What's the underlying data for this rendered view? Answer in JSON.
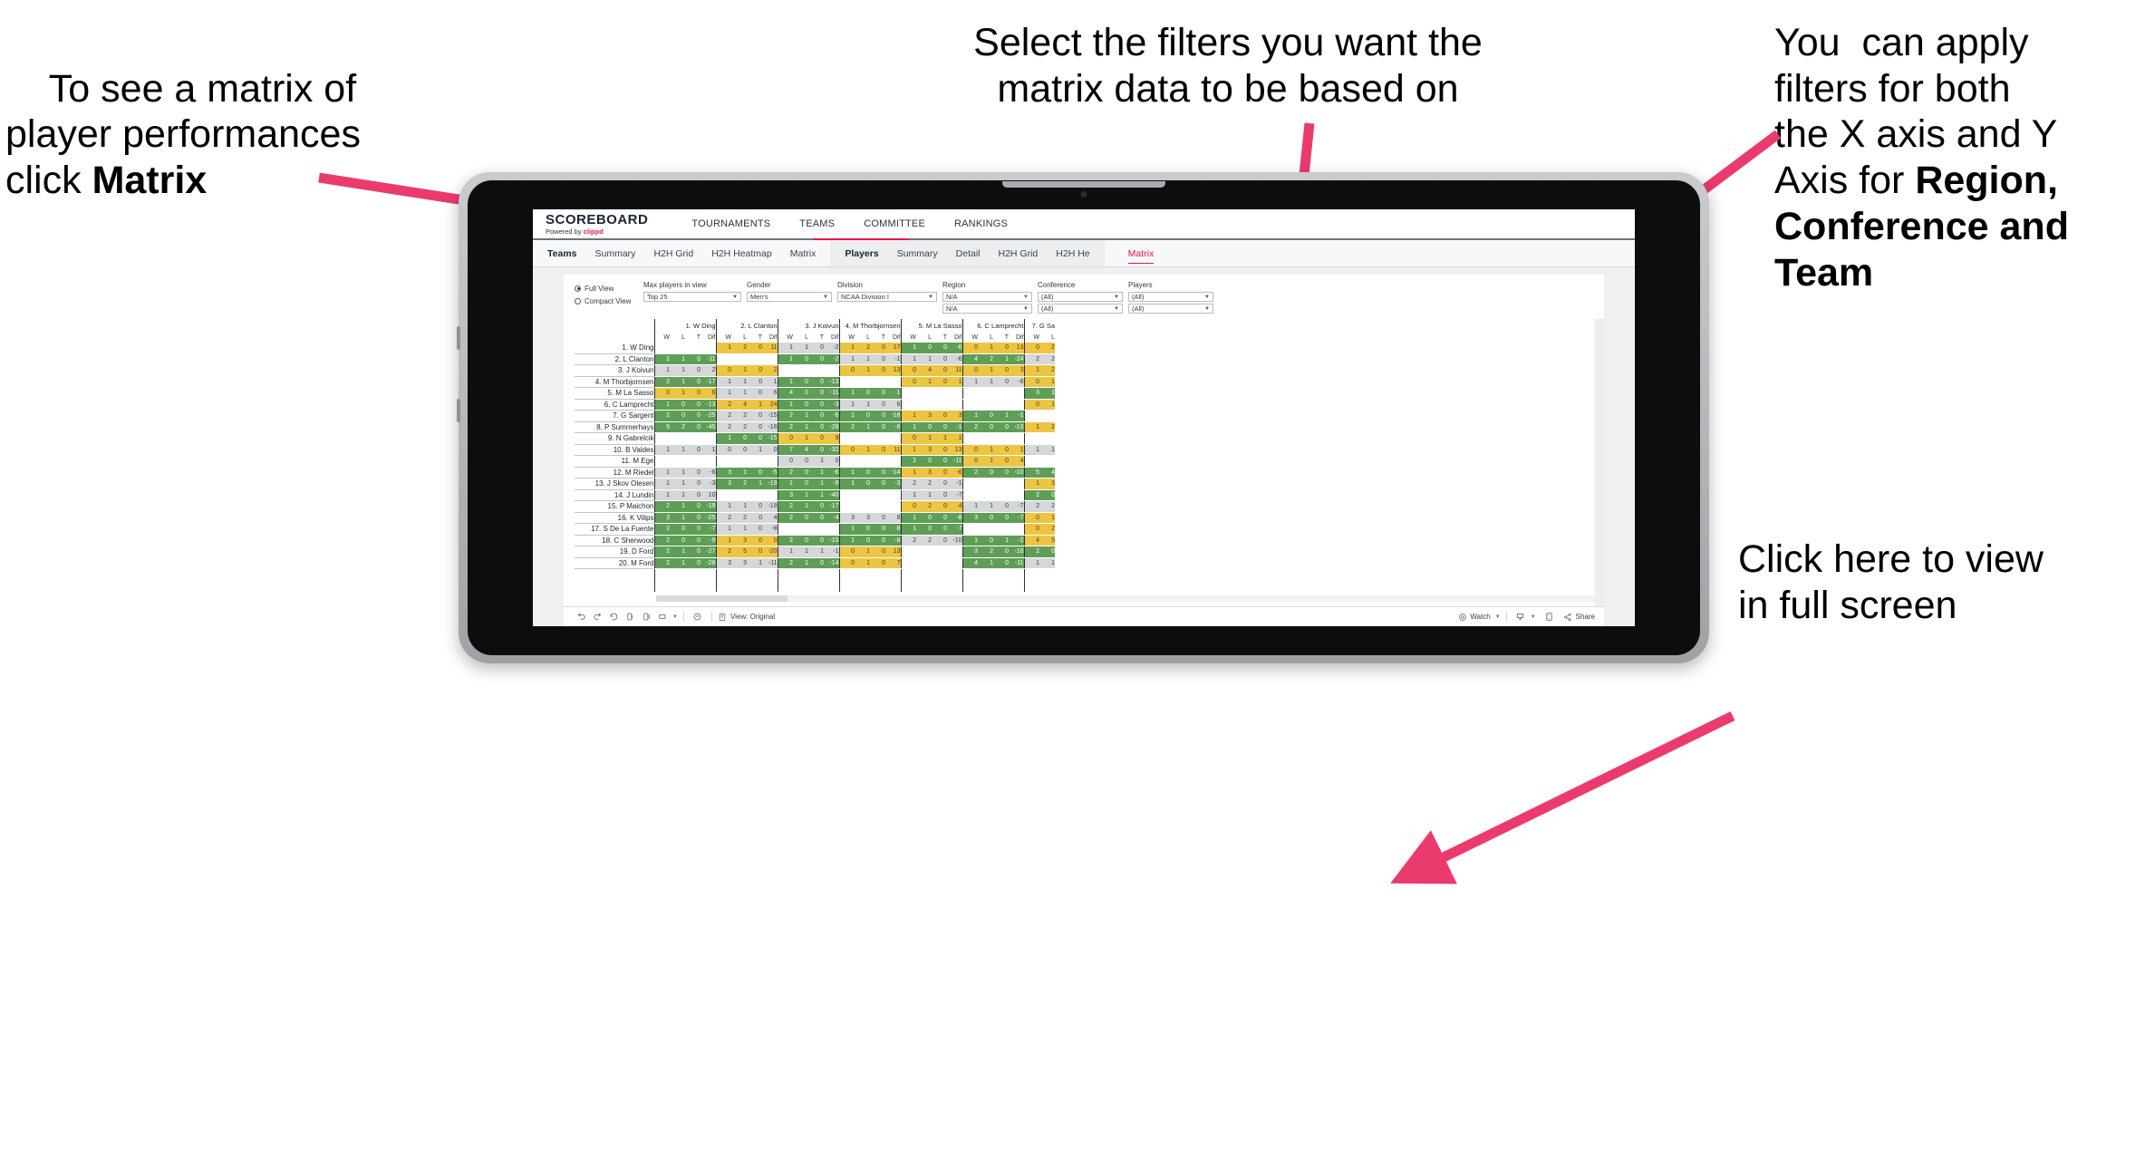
{
  "annotations": [
    {
      "id": "anno-matrix",
      "plain1": "To see a matrix of\nplayer performances\nclick ",
      "bold": "Matrix",
      "plain2": ""
    },
    {
      "id": "anno-filters",
      "text": "Select the filters you want the\nmatrix data to be based on"
    },
    {
      "id": "anno-axis",
      "plain1": "You  can apply\nfilters for both\nthe X axis and Y\nAxis for ",
      "bold": "Region,\nConference and\nTeam",
      "plain2": ""
    },
    {
      "id": "anno-fullscreen",
      "text": "Click here to view\nin full screen"
    }
  ],
  "colors": {
    "arrow": "#eb3b6e",
    "accent": "#e8174e",
    "win": "#5f9e57",
    "loss": "#ecc543",
    "neutral": "#d5d7d9"
  },
  "app": {
    "brand": {
      "name": "SCOREBOARD",
      "powered_prefix": "Powered by ",
      "powered_brand": "clippd"
    },
    "topnav": [
      "TOURNAMENTS",
      "TEAMS",
      "COMMITTEE",
      "RANKINGS"
    ],
    "subnav_teams": {
      "head": "Teams",
      "items": [
        "Summary",
        "H2H Grid",
        "H2H Heatmap",
        "Matrix"
      ]
    },
    "subnav_players": {
      "head": "Players",
      "items": [
        "Summary",
        "Detail",
        "H2H Grid",
        "H2H He"
      ],
      "active": "Matrix"
    }
  },
  "filters": {
    "view_modes": [
      {
        "label": "Full View",
        "selected": true
      },
      {
        "label": "Compact View",
        "selected": false
      }
    ],
    "controls": [
      {
        "name": "max-players",
        "label": "Max players in view",
        "value": "Top 25",
        "width": "w-maxp",
        "second": null
      },
      {
        "name": "gender",
        "label": "Gender",
        "value": "Men's",
        "width": "w-gen",
        "second": null
      },
      {
        "name": "division",
        "label": "Division",
        "value": "NCAA Division I",
        "width": "w-div",
        "second": null
      },
      {
        "name": "region",
        "label": "Region",
        "value": "N/A",
        "width": "w-reg",
        "second": "N/A"
      },
      {
        "name": "conference",
        "label": "Conference",
        "value": "(All)",
        "width": "w-conf",
        "second": "(All)"
      },
      {
        "name": "players",
        "label": "Players",
        "value": "(All)",
        "width": "w-play",
        "second": "(All)"
      }
    ]
  },
  "toolbar": {
    "view_label": "View: Original",
    "watch_label": "Watch",
    "share_label": "Share"
  },
  "chart_data": {
    "type": "table",
    "title": "Player head-to-head matrix",
    "subcolumns": [
      "W",
      "L",
      "T",
      "Dif"
    ],
    "columns": [
      "1. W Ding",
      "2. L Clanton",
      "3. J Koivun",
      "4. M Thorbjornsen",
      "5. M La Sasso",
      "6. C Lamprecht",
      "7. G Sa"
    ],
    "rows": [
      "1. W Ding",
      "2. L Clanton",
      "3. J Koivun",
      "4. M Thorbjornsen",
      "5. M La Sasso",
      "6. C Lamprecht",
      "7. G Sargent",
      "8. P Summerhays",
      "9. N Gabrelcik",
      "10. B Valdes",
      "11. M Ege",
      "12. M Riedel",
      "13. J Skov Olesen",
      "14. J Lundin",
      "15. P Maichon",
      "16. K Vilips",
      "17. S De La Fuente",
      "18. C Sherwood",
      "19. D Ford",
      "20. M Ford"
    ],
    "cells": [
      [
        {
          "t": "e"
        },
        {
          "t": "y",
          "v": [
            1,
            2,
            0,
            11
          ]
        },
        {
          "t": "n",
          "v": [
            1,
            1,
            0,
            -2
          ]
        },
        {
          "t": "y",
          "v": [
            1,
            2,
            0,
            17
          ]
        },
        {
          "t": "g",
          "v": [
            1,
            0,
            0,
            -6
          ]
        },
        {
          "t": "y",
          "v": [
            0,
            1,
            0,
            13
          ]
        },
        {
          "t": "y",
          "v": [
            0,
            2
          ]
        }
      ],
      [
        {
          "t": "g",
          "v": [
            2,
            1,
            0,
            -11
          ]
        },
        {
          "t": "e"
        },
        {
          "t": "g",
          "v": [
            1,
            0,
            0,
            -2
          ]
        },
        {
          "t": "n",
          "v": [
            1,
            1,
            0,
            -1
          ]
        },
        {
          "t": "n",
          "v": [
            1,
            1,
            0,
            -6
          ]
        },
        {
          "t": "g",
          "v": [
            4,
            2,
            1,
            -24
          ]
        },
        {
          "t": "n",
          "v": [
            2,
            2
          ]
        }
      ],
      [
        {
          "t": "n",
          "v": [
            1,
            1,
            0,
            2
          ]
        },
        {
          "t": "y",
          "v": [
            0,
            1,
            0,
            2
          ]
        },
        {
          "t": "e"
        },
        {
          "t": "y",
          "v": [
            0,
            1,
            0,
            13
          ]
        },
        {
          "t": "y",
          "v": [
            0,
            4,
            0,
            11
          ]
        },
        {
          "t": "y",
          "v": [
            0,
            1,
            0,
            3
          ]
        },
        {
          "t": "y",
          "v": [
            1,
            2
          ]
        }
      ],
      [
        {
          "t": "g",
          "v": [
            2,
            1,
            0,
            -17
          ]
        },
        {
          "t": "n",
          "v": [
            1,
            1,
            0,
            1
          ]
        },
        {
          "t": "g",
          "v": [
            1,
            0,
            0,
            -13
          ]
        },
        {
          "t": "e"
        },
        {
          "t": "y",
          "v": [
            0,
            1,
            0,
            1
          ]
        },
        {
          "t": "n",
          "v": [
            1,
            1,
            0,
            -6
          ]
        },
        {
          "t": "y",
          "v": [
            0,
            1
          ]
        }
      ],
      [
        {
          "t": "y",
          "v": [
            0,
            1,
            0,
            6
          ]
        },
        {
          "t": "n",
          "v": [
            1,
            1,
            0,
            6
          ]
        },
        {
          "t": "g",
          "v": [
            4,
            0,
            0,
            -11
          ]
        },
        {
          "t": "g",
          "v": [
            1,
            0,
            0,
            -1
          ]
        },
        {
          "t": "e"
        },
        {
          "t": "e"
        },
        {
          "t": "g",
          "v": [
            3,
            1
          ]
        }
      ],
      [
        {
          "t": "g",
          "v": [
            1,
            0,
            0,
            -13
          ]
        },
        {
          "t": "y",
          "v": [
            2,
            4,
            1,
            24
          ]
        },
        {
          "t": "g",
          "v": [
            1,
            0,
            0,
            -3
          ]
        },
        {
          "t": "n",
          "v": [
            1,
            1,
            0,
            6
          ]
        },
        {
          "t": "e"
        },
        {
          "t": "e"
        },
        {
          "t": "y",
          "v": [
            0,
            1
          ]
        }
      ],
      [
        {
          "t": "g",
          "v": [
            2,
            0,
            0,
            -25
          ]
        },
        {
          "t": "n",
          "v": [
            2,
            2,
            0,
            -15
          ]
        },
        {
          "t": "g",
          "v": [
            2,
            1,
            0,
            -6
          ]
        },
        {
          "t": "g",
          "v": [
            1,
            0,
            0,
            -16
          ]
        },
        {
          "t": "y",
          "v": [
            1,
            3,
            0,
            3
          ]
        },
        {
          "t": "g",
          "v": [
            1,
            0,
            1,
            -1
          ]
        },
        {
          "t": "e"
        }
      ],
      [
        {
          "t": "g",
          "v": [
            5,
            2,
            0,
            -45
          ]
        },
        {
          "t": "n",
          "v": [
            2,
            2,
            0,
            -16
          ]
        },
        {
          "t": "g",
          "v": [
            2,
            1,
            0,
            -28
          ]
        },
        {
          "t": "g",
          "v": [
            2,
            1,
            0,
            -6
          ]
        },
        {
          "t": "g",
          "v": [
            1,
            0,
            0,
            -1
          ]
        },
        {
          "t": "g",
          "v": [
            2,
            0,
            0,
            -13
          ]
        },
        {
          "t": "y",
          "v": [
            1,
            2
          ]
        }
      ],
      [
        {
          "t": "e"
        },
        {
          "t": "g",
          "v": [
            1,
            0,
            0,
            -15
          ]
        },
        {
          "t": "y",
          "v": [
            0,
            1,
            0,
            9
          ]
        },
        {
          "t": "e"
        },
        {
          "t": "y",
          "v": [
            0,
            1,
            1,
            1
          ]
        },
        {
          "t": "e"
        },
        {
          "t": "e"
        }
      ],
      [
        {
          "t": "n",
          "v": [
            1,
            1,
            0,
            1
          ]
        },
        {
          "t": "n",
          "v": [
            0,
            0,
            1,
            0
          ]
        },
        {
          "t": "g",
          "v": [
            7,
            4,
            0,
            -32
          ]
        },
        {
          "t": "y",
          "v": [
            0,
            1,
            0,
            11
          ]
        },
        {
          "t": "y",
          "v": [
            1,
            3,
            0,
            13
          ]
        },
        {
          "t": "y",
          "v": [
            0,
            1,
            0,
            1
          ]
        },
        {
          "t": "n",
          "v": [
            1,
            1
          ]
        }
      ],
      [
        {
          "t": "e"
        },
        {
          "t": "e"
        },
        {
          "t": "n",
          "v": [
            0,
            0,
            1,
            0
          ]
        },
        {
          "t": "e"
        },
        {
          "t": "g",
          "v": [
            2,
            0,
            0,
            -11
          ]
        },
        {
          "t": "y",
          "v": [
            0,
            1,
            0,
            4
          ]
        },
        {
          "t": "e"
        }
      ],
      [
        {
          "t": "n",
          "v": [
            1,
            1,
            0,
            -6
          ]
        },
        {
          "t": "g",
          "v": [
            3,
            1,
            0,
            -5
          ]
        },
        {
          "t": "g",
          "v": [
            2,
            0,
            1,
            -6
          ]
        },
        {
          "t": "g",
          "v": [
            1,
            0,
            0,
            -14
          ]
        },
        {
          "t": "y",
          "v": [
            1,
            3,
            0,
            -6
          ]
        },
        {
          "t": "g",
          "v": [
            2,
            0,
            0,
            -10
          ]
        },
        {
          "t": "g",
          "v": [
            5,
            4
          ]
        }
      ],
      [
        {
          "t": "n",
          "v": [
            1,
            1,
            0,
            -3
          ]
        },
        {
          "t": "g",
          "v": [
            3,
            2,
            1,
            -19
          ]
        },
        {
          "t": "g",
          "v": [
            1,
            0,
            1,
            -9
          ]
        },
        {
          "t": "g",
          "v": [
            1,
            0,
            0,
            -3
          ]
        },
        {
          "t": "n",
          "v": [
            2,
            2,
            0,
            -1
          ]
        },
        {
          "t": "e"
        },
        {
          "t": "y",
          "v": [
            1,
            3
          ]
        }
      ],
      [
        {
          "t": "n",
          "v": [
            1,
            1,
            0,
            10
          ]
        },
        {
          "t": "e"
        },
        {
          "t": "g",
          "v": [
            3,
            1,
            1,
            -40
          ]
        },
        {
          "t": "e"
        },
        {
          "t": "n",
          "v": [
            1,
            1,
            0,
            -7
          ]
        },
        {
          "t": "e"
        },
        {
          "t": "g",
          "v": [
            2,
            0
          ]
        }
      ],
      [
        {
          "t": "g",
          "v": [
            2,
            1,
            0,
            -19
          ]
        },
        {
          "t": "n",
          "v": [
            1,
            1,
            0,
            -19
          ]
        },
        {
          "t": "g",
          "v": [
            2,
            1,
            0,
            -17
          ]
        },
        {
          "t": "e"
        },
        {
          "t": "y",
          "v": [
            0,
            2,
            0,
            4
          ]
        },
        {
          "t": "n",
          "v": [
            1,
            1,
            0,
            -7
          ]
        },
        {
          "t": "n",
          "v": [
            2,
            2
          ]
        }
      ],
      [
        {
          "t": "g",
          "v": [
            3,
            1,
            0,
            -25
          ]
        },
        {
          "t": "n",
          "v": [
            2,
            2,
            0,
            4
          ]
        },
        {
          "t": "g",
          "v": [
            2,
            0,
            0,
            -4
          ]
        },
        {
          "t": "n",
          "v": [
            3,
            3,
            0,
            8
          ]
        },
        {
          "t": "g",
          "v": [
            1,
            0,
            0,
            -8
          ]
        },
        {
          "t": "g",
          "v": [
            3,
            0,
            0,
            -7
          ]
        },
        {
          "t": "y",
          "v": [
            0,
            1
          ]
        }
      ],
      [
        {
          "t": "g",
          "v": [
            2,
            0,
            0,
            -7
          ]
        },
        {
          "t": "n",
          "v": [
            1,
            1,
            0,
            -8
          ]
        },
        {
          "t": "e"
        },
        {
          "t": "g",
          "v": [
            1,
            0,
            0,
            -8
          ]
        },
        {
          "t": "g",
          "v": [
            1,
            0,
            0,
            -7
          ]
        },
        {
          "t": "e"
        },
        {
          "t": "y",
          "v": [
            0,
            2
          ]
        }
      ],
      [
        {
          "t": "g",
          "v": [
            2,
            0,
            0,
            -9
          ]
        },
        {
          "t": "y",
          "v": [
            1,
            3,
            0,
            0
          ]
        },
        {
          "t": "g",
          "v": [
            2,
            0,
            0,
            -15
          ]
        },
        {
          "t": "g",
          "v": [
            1,
            0,
            0,
            -8
          ]
        },
        {
          "t": "n",
          "v": [
            2,
            2,
            0,
            -10
          ]
        },
        {
          "t": "g",
          "v": [
            1,
            0,
            1,
            -2
          ]
        },
        {
          "t": "y",
          "v": [
            4,
            5
          ]
        }
      ],
      [
        {
          "t": "g",
          "v": [
            2,
            1,
            0,
            -27
          ]
        },
        {
          "t": "y",
          "v": [
            2,
            5,
            0,
            -20
          ]
        },
        {
          "t": "n",
          "v": [
            1,
            1,
            1,
            -1
          ]
        },
        {
          "t": "y",
          "v": [
            0,
            1,
            0,
            13
          ]
        },
        {
          "t": "e"
        },
        {
          "t": "g",
          "v": [
            3,
            2,
            0,
            -16
          ]
        },
        {
          "t": "g",
          "v": [
            2,
            0
          ]
        }
      ],
      [
        {
          "t": "g",
          "v": [
            2,
            1,
            0,
            -28
          ]
        },
        {
          "t": "n",
          "v": [
            3,
            3,
            1,
            -11
          ]
        },
        {
          "t": "g",
          "v": [
            2,
            1,
            0,
            -14
          ]
        },
        {
          "t": "y",
          "v": [
            0,
            1,
            0,
            7
          ]
        },
        {
          "t": "e"
        },
        {
          "t": "g",
          "v": [
            4,
            1,
            0,
            -11
          ]
        },
        {
          "t": "n",
          "v": [
            1,
            1
          ]
        }
      ]
    ]
  }
}
